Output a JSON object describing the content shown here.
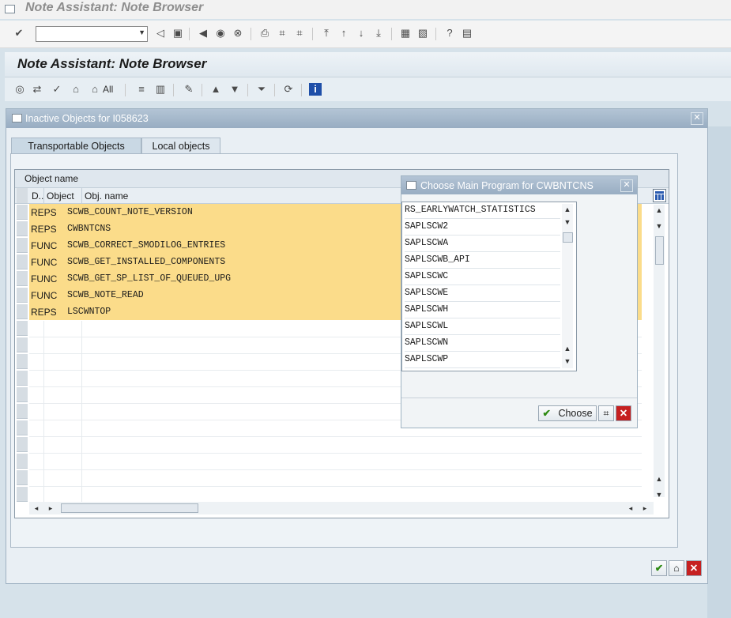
{
  "window": {
    "title": "Note Assistant: Note Browser"
  },
  "toolbar": {
    "command_field_value": "",
    "icons": [
      "enter-icon",
      "back-icon",
      "save-icon",
      "back-nav-icon",
      "exit-icon",
      "cancel-icon",
      "print-icon",
      "find-icon",
      "find-next-icon",
      "first-page-icon",
      "prev-page-icon",
      "next-page-icon",
      "last-page-icon",
      "new-session-icon",
      "shortcut-icon",
      "help-icon",
      "customize-icon"
    ]
  },
  "app": {
    "title": "Note Assistant: Note Browser",
    "toolbar_all_label": "All"
  },
  "popup": {
    "title": "Inactive Objects for I058623",
    "tabs": [
      {
        "label": "Transportable Objects"
      },
      {
        "label": "Local objects"
      }
    ],
    "grid": {
      "header": "Object name",
      "columns": [
        "D..",
        "Object",
        "Obj. name"
      ],
      "rows": [
        {
          "object": "REPS",
          "name": "SCWB_COUNT_NOTE_VERSION"
        },
        {
          "object": "REPS",
          "name": "CWBNTCNS"
        },
        {
          "object": "FUNC",
          "name": "SCWB_CORRECT_SMODILOG_ENTRIES"
        },
        {
          "object": "FUNC",
          "name": "SCWB_GET_INSTALLED_COMPONENTS"
        },
        {
          "object": "FUNC",
          "name": "SCWB_GET_SP_LIST_OF_QUEUED_UPG"
        },
        {
          "object": "FUNC",
          "name": "SCWB_NOTE_READ"
        },
        {
          "object": "REPS",
          "name": "LSCWNTOP"
        }
      ]
    }
  },
  "chooser": {
    "title": "Choose Main Program for CWBNTCNS",
    "items": [
      "RS_EARLYWATCH_STATISTICS",
      "SAPLSCW2",
      "SAPLSCWA",
      "SAPLSCWB_API",
      "SAPLSCWC",
      "SAPLSCWE",
      "SAPLSCWH",
      "SAPLSCWL",
      "SAPLSCWN",
      "SAPLSCWP"
    ],
    "choose_label": "Choose"
  },
  "colors": {
    "row_highlight": "#fbdc8a",
    "title_bar": "#9fb3c7"
  }
}
